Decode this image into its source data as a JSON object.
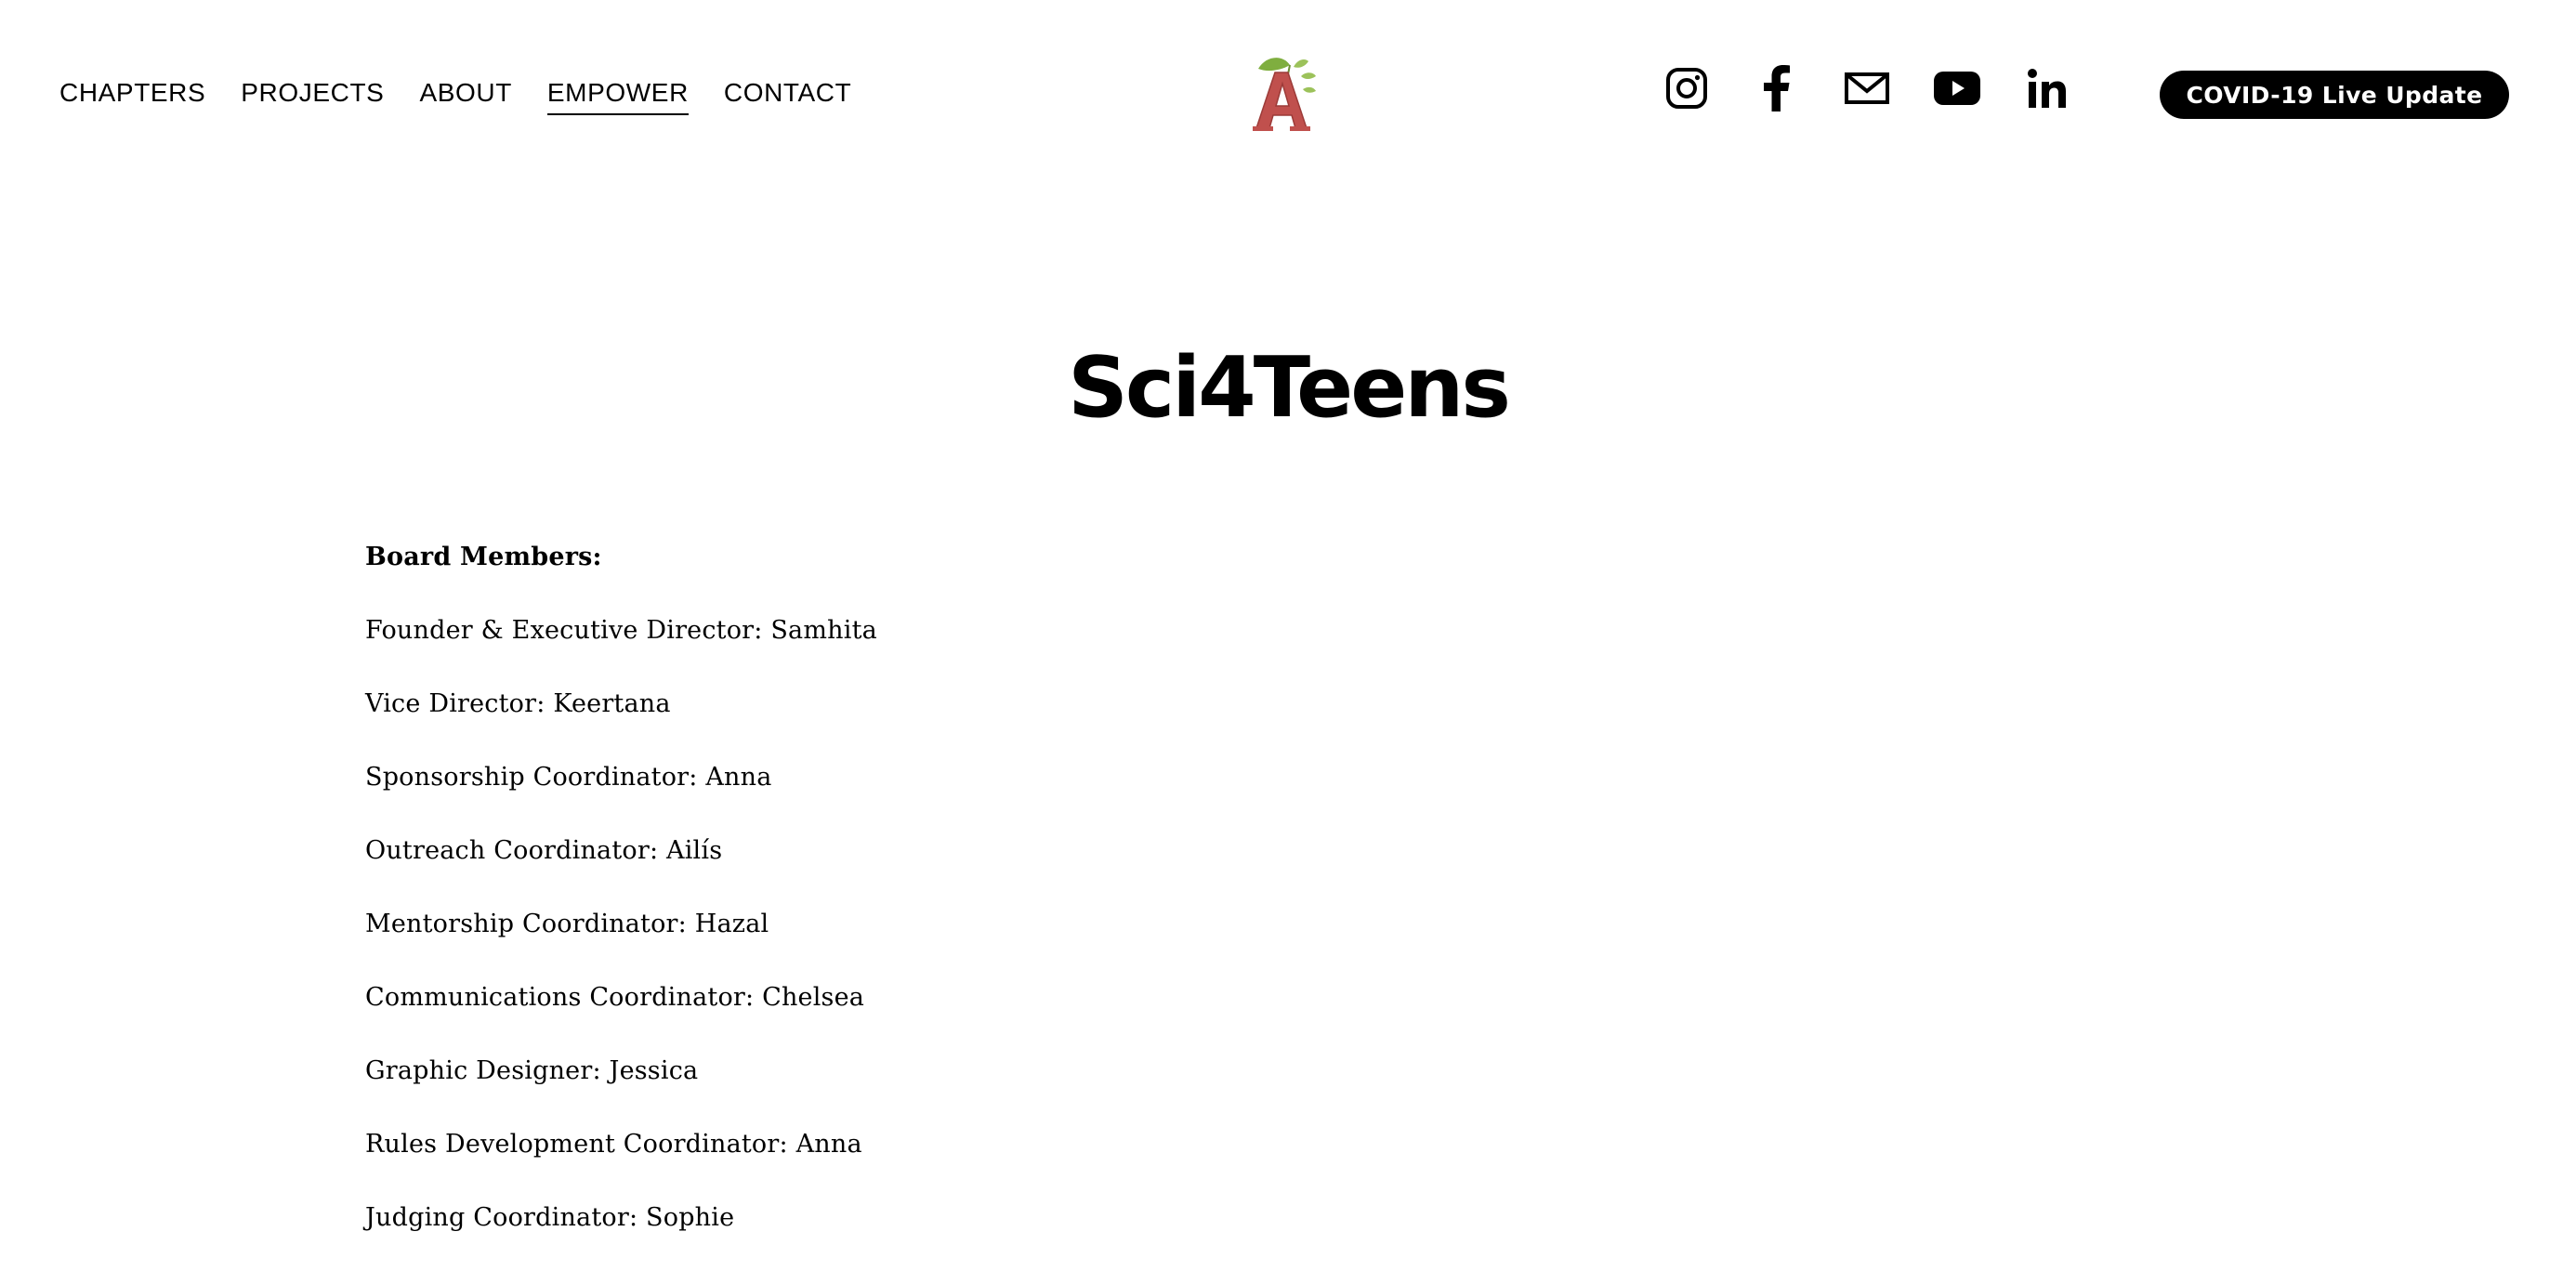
{
  "header": {
    "nav": [
      {
        "label": "CHAPTERS",
        "active": false
      },
      {
        "label": "PROJECTS",
        "active": false
      },
      {
        "label": "ABOUT",
        "active": false
      },
      {
        "label": "EMPOWER",
        "active": true
      },
      {
        "label": "CONTACT",
        "active": false
      }
    ],
    "logo": {
      "icon": "apple-letter-a-logo",
      "letter": "A",
      "letter_color": "#c0504d",
      "leaf_color": "#7fae3f"
    },
    "social_icons": [
      "instagram-icon",
      "facebook-icon",
      "email-icon",
      "youtube-icon",
      "linkedin-icon"
    ],
    "cta_label": "COVID-19 Live Update"
  },
  "main": {
    "title": "Sci4Teens",
    "heading": "Board Members:",
    "members": [
      "Founder & Executive Director: Samhita",
      "Vice Director: Keertana",
      "Sponsorship Coordinator: Anna",
      "Outreach Coordinator: Ailís",
      "Mentorship Coordinator: Hazal",
      "Communications Coordinator: Chelsea",
      "Graphic Designer: Jessica",
      "Rules Development Coordinator: Anna",
      "Judging Coordinator: Sophie"
    ]
  },
  "colors": {
    "background": "#ffffff",
    "text": "#000000",
    "button_bg": "#000000",
    "button_text": "#ffffff"
  }
}
